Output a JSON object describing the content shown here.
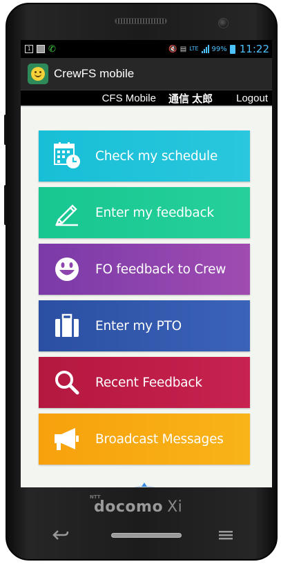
{
  "status_bar": {
    "notif_box_label": "1",
    "battery_percent": "99%",
    "network_type": "LTE",
    "time": "11:22"
  },
  "action_bar": {
    "app_title": "CrewFS mobile"
  },
  "user_bar": {
    "app_name": "CFS Mobile",
    "user_name": "通信 太郎",
    "logout_label": "Logout"
  },
  "menu": {
    "items": [
      {
        "label": "Check my schedule",
        "icon": "calendar-clock-icon",
        "color": "#1fc3da"
      },
      {
        "label": "Enter my feedback",
        "icon": "pencil-icon",
        "color": "#1fca95"
      },
      {
        "label": "FO feedback to Crew",
        "icon": "smiley-icon",
        "color": "#8e44ad"
      },
      {
        "label": "Enter my PTO",
        "icon": "briefcase-icon",
        "color": "#3459ad"
      },
      {
        "label": "Recent Feedback",
        "icon": "search-icon",
        "color": "#bd1d47"
      },
      {
        "label": "Broadcast Messages",
        "icon": "megaphone-icon",
        "color": "#f7aa12"
      }
    ]
  },
  "device": {
    "carrier_prefix": "NTT",
    "carrier_brand": "docomo",
    "carrier_suffix": "Xi"
  }
}
